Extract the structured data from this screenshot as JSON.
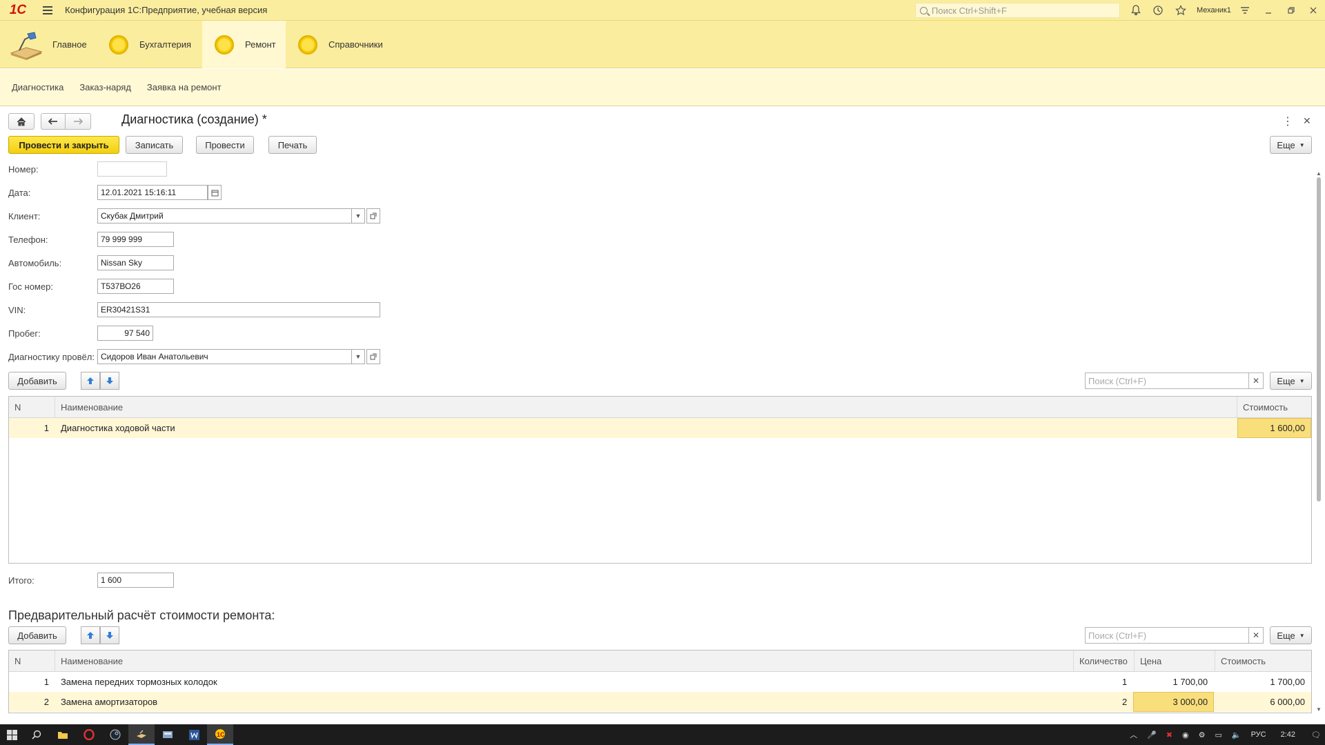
{
  "app": {
    "logo": "1С",
    "title": "Конфигурация 1С:Предприятие, учебная версия",
    "search_placeholder": "Поиск Ctrl+Shift+F",
    "user": "Механик1"
  },
  "sections": [
    {
      "label": "Главное",
      "active": false
    },
    {
      "label": "Бухгалтерия",
      "active": false
    },
    {
      "label": "Ремонт",
      "active": true
    },
    {
      "label": "Справочники",
      "active": false
    }
  ],
  "subsections": [
    "Диагностика",
    "Заказ-наряд",
    "Заявка на ремонт"
  ],
  "form": {
    "title": "Диагностика (создание) *",
    "buttons": {
      "post_close": "Провести и закрыть",
      "save": "Записать",
      "post": "Провести",
      "print": "Печать",
      "more": "Еще"
    },
    "fields": {
      "number_label": "Номер:",
      "number_value": "",
      "date_label": "Дата:",
      "date_value": "12.01.2021 15:16:11",
      "client_label": "Клиент:",
      "client_value": "Скубак Дмитрий",
      "phone_label": "Телефон:",
      "phone_value": "79 999 999",
      "car_label": "Автомобиль:",
      "car_value": "Nissan Sky",
      "plate_label": "Гос номер:",
      "plate_value": "Т537ВО26",
      "vin_label": "VIN:",
      "vin_value": "ER30421S31",
      "mileage_label": "Пробег:",
      "mileage_value": "97 540",
      "diag_label": "Диагностику провёл:",
      "diag_value": "Сидоров Иван Анатольевич",
      "total_label": "Итого:",
      "total_value": "1 600"
    }
  },
  "table1": {
    "add_label": "Добавить",
    "search_placeholder": "Поиск (Ctrl+F)",
    "more_label": "Еще",
    "columns": [
      "N",
      "Наименование",
      "Стоимость"
    ],
    "rows": [
      {
        "n": "1",
        "name": "Диагностика ходовой части",
        "cost": "1 600,00"
      }
    ]
  },
  "table2": {
    "title": "Предварительный расчёт стоимости ремонта:",
    "add_label": "Добавить",
    "search_placeholder": "Поиск (Ctrl+F)",
    "more_label": "Еще",
    "columns": [
      "N",
      "Наименование",
      "Количество",
      "Цена",
      "Стоимость"
    ],
    "rows": [
      {
        "n": "1",
        "name": "Замена передних тормозных колодок",
        "qty": "1",
        "price": "1 700,00",
        "cost": "1 700,00"
      },
      {
        "n": "2",
        "name": "Замена амортизаторов",
        "qty": "2",
        "price": "3 000,00",
        "cost": "6 000,00"
      }
    ]
  },
  "taskbar": {
    "language": "РУС",
    "time": "2:42"
  },
  "colors": {
    "accent_yellow": "#fbed9e",
    "primary_button": "#f4cf0f",
    "selected_row": "#fff7d6"
  }
}
